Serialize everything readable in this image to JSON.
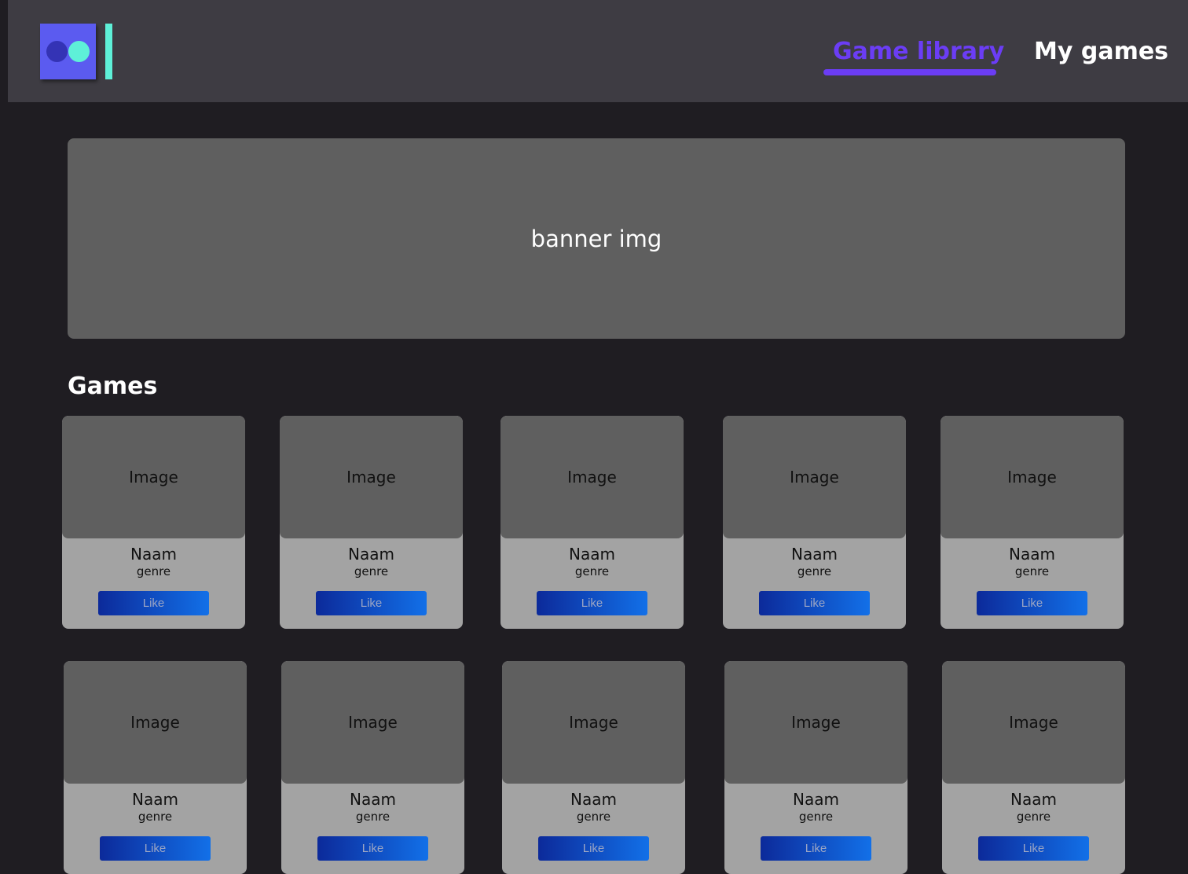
{
  "nav": {
    "items": [
      {
        "label": "Game library",
        "active": true
      },
      {
        "label": "My games",
        "active": false
      }
    ],
    "active_color": "#6b3df5"
  },
  "banner": {
    "label": "banner img"
  },
  "section": {
    "title": "Games"
  },
  "card_template": {
    "image_label": "Image",
    "name": "Naam",
    "genre": "genre",
    "like_label": "Like"
  },
  "colors": {
    "background": "#1f1d22",
    "header": "#3e3c43",
    "logo_primary": "#5b5bf0",
    "logo_accent": "#5ef0d8",
    "placeholder": "#5f5f5f",
    "card": "#a3a3a3",
    "button_start": "#0c2a9a",
    "button_end": "#1270e8"
  }
}
